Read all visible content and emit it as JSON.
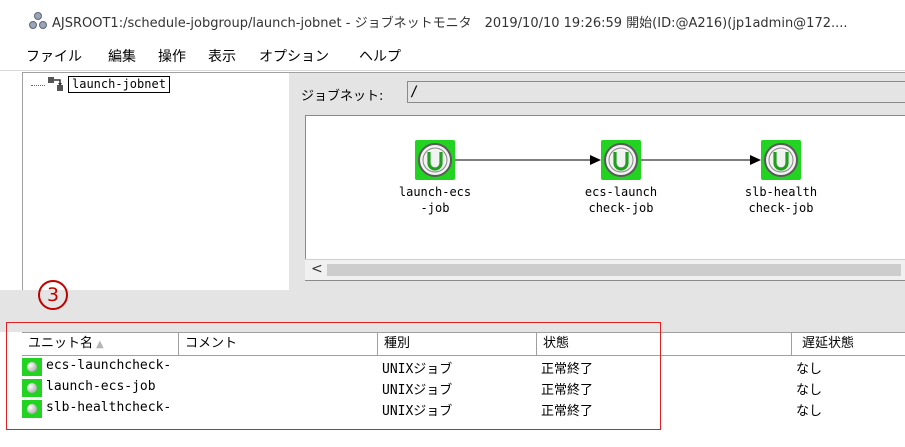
{
  "window": {
    "title": "AJSROOT1:/schedule-jobgroup/launch-jobnet - ジョブネットモニタ　2019/10/10 19:26:59 開始(ID:@A216)(jp1admin@172...."
  },
  "menu": {
    "items": [
      {
        "label": "ファイル"
      },
      {
        "label": "編集"
      },
      {
        "label": "操作"
      },
      {
        "label": "表示"
      },
      {
        "label": "オプション"
      },
      {
        "label": "ヘルプ"
      }
    ]
  },
  "tree": {
    "root_label": "launch-jobnet"
  },
  "jobnet_bar": {
    "label": "ジョブネット:",
    "value": "/"
  },
  "jobs": [
    {
      "name": "launch-ecs\n-job",
      "icon": "unix-job-icon"
    },
    {
      "name": "ecs-launch\ncheck-job",
      "icon": "unix-job-icon"
    },
    {
      "name": "slb-health\ncheck-job",
      "icon": "unix-job-icon"
    }
  ],
  "scroll": {
    "left_arrow": "<"
  },
  "annotation": {
    "number": "3"
  },
  "table": {
    "columns": [
      {
        "label": "ユニット名"
      },
      {
        "label": "コメント"
      },
      {
        "label": "種別"
      },
      {
        "label": "状態"
      },
      {
        "label": "遅延状態"
      }
    ],
    "sort_indicator": "▲",
    "rows": [
      {
        "unit": "ecs-launchcheck-",
        "comment": "",
        "type": "UNIXジョブ",
        "status": "正常終了",
        "delay": "なし"
      },
      {
        "unit": "launch-ecs-job",
        "comment": "",
        "type": "UNIXジョブ",
        "status": "正常終了",
        "delay": "なし"
      },
      {
        "unit": "slb-healthcheck-",
        "comment": "",
        "type": "UNIXジョブ",
        "status": "正常終了",
        "delay": "なし"
      }
    ]
  },
  "colors": {
    "job_green": "#22d322",
    "annotation_red": "#e02020",
    "pane_gray": "#e4e4e4"
  }
}
